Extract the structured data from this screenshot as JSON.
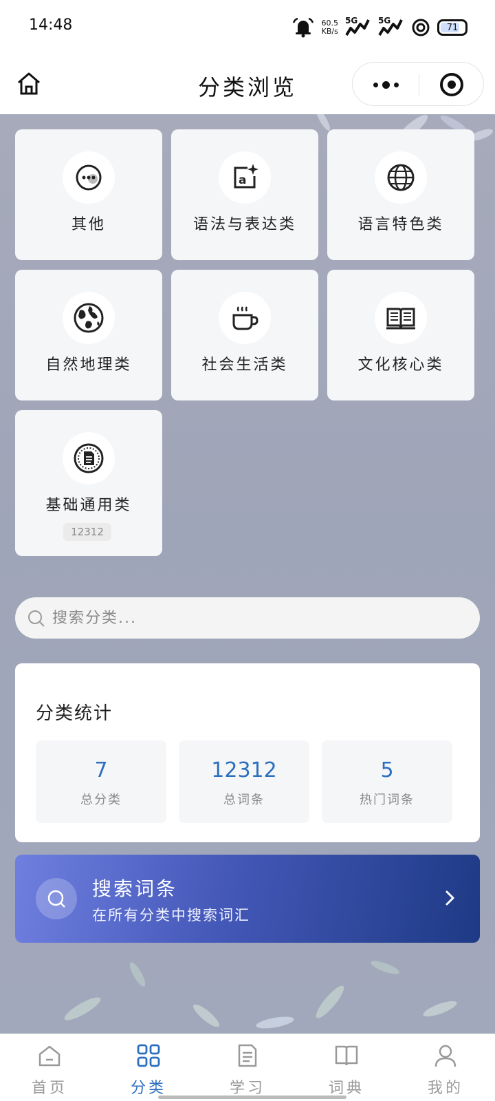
{
  "status_bar": {
    "time": "14:48",
    "net_speed_value": "60.5",
    "net_speed_unit": "KB/s",
    "signal1_label": "5G",
    "signal2_label": "5G",
    "battery": "71",
    "icons": [
      "alarm-icon",
      "signal-icon",
      "signal-icon",
      "hotspot-icon",
      "battery-icon"
    ]
  },
  "nav": {
    "title": "分类浏览",
    "icons": [
      "home-icon",
      "more-icon",
      "close-target-icon"
    ]
  },
  "categories": [
    {
      "label": "其他",
      "icon": "chat-bubble-icon"
    },
    {
      "label": "语法与表达类",
      "icon": "ai-text-icon"
    },
    {
      "label": "语言特色类",
      "icon": "globe-icon"
    },
    {
      "label": "自然地理类",
      "icon": "earth-icon"
    },
    {
      "label": "社会生活类",
      "icon": "coffee-cup-icon"
    },
    {
      "label": "文化核心类",
      "icon": "open-book-icon"
    },
    {
      "label": "基础通用类",
      "icon": "document-badge-icon",
      "count": "12312"
    }
  ],
  "search": {
    "placeholder": "搜索分类..."
  },
  "stats": {
    "title": "分类统计",
    "items": [
      {
        "value": "7",
        "label": "总分类"
      },
      {
        "value": "12312",
        "label": "总词条"
      },
      {
        "value": "5",
        "label": "热门词条"
      }
    ]
  },
  "banner": {
    "title": "搜索词条",
    "subtitle": "在所有分类中搜索词汇",
    "gradient_start": "#6f7fe0",
    "gradient_end": "#1e3a85"
  },
  "tabbar": {
    "active_color": "#2c6fbf",
    "items": [
      {
        "label": "首页",
        "icon": "home-icon",
        "active": false
      },
      {
        "label": "分类",
        "icon": "grid-icon",
        "active": true
      },
      {
        "label": "学习",
        "icon": "document-icon",
        "active": false
      },
      {
        "label": "词典",
        "icon": "book-icon",
        "active": false
      },
      {
        "label": "我的",
        "icon": "user-icon",
        "active": false
      }
    ]
  }
}
